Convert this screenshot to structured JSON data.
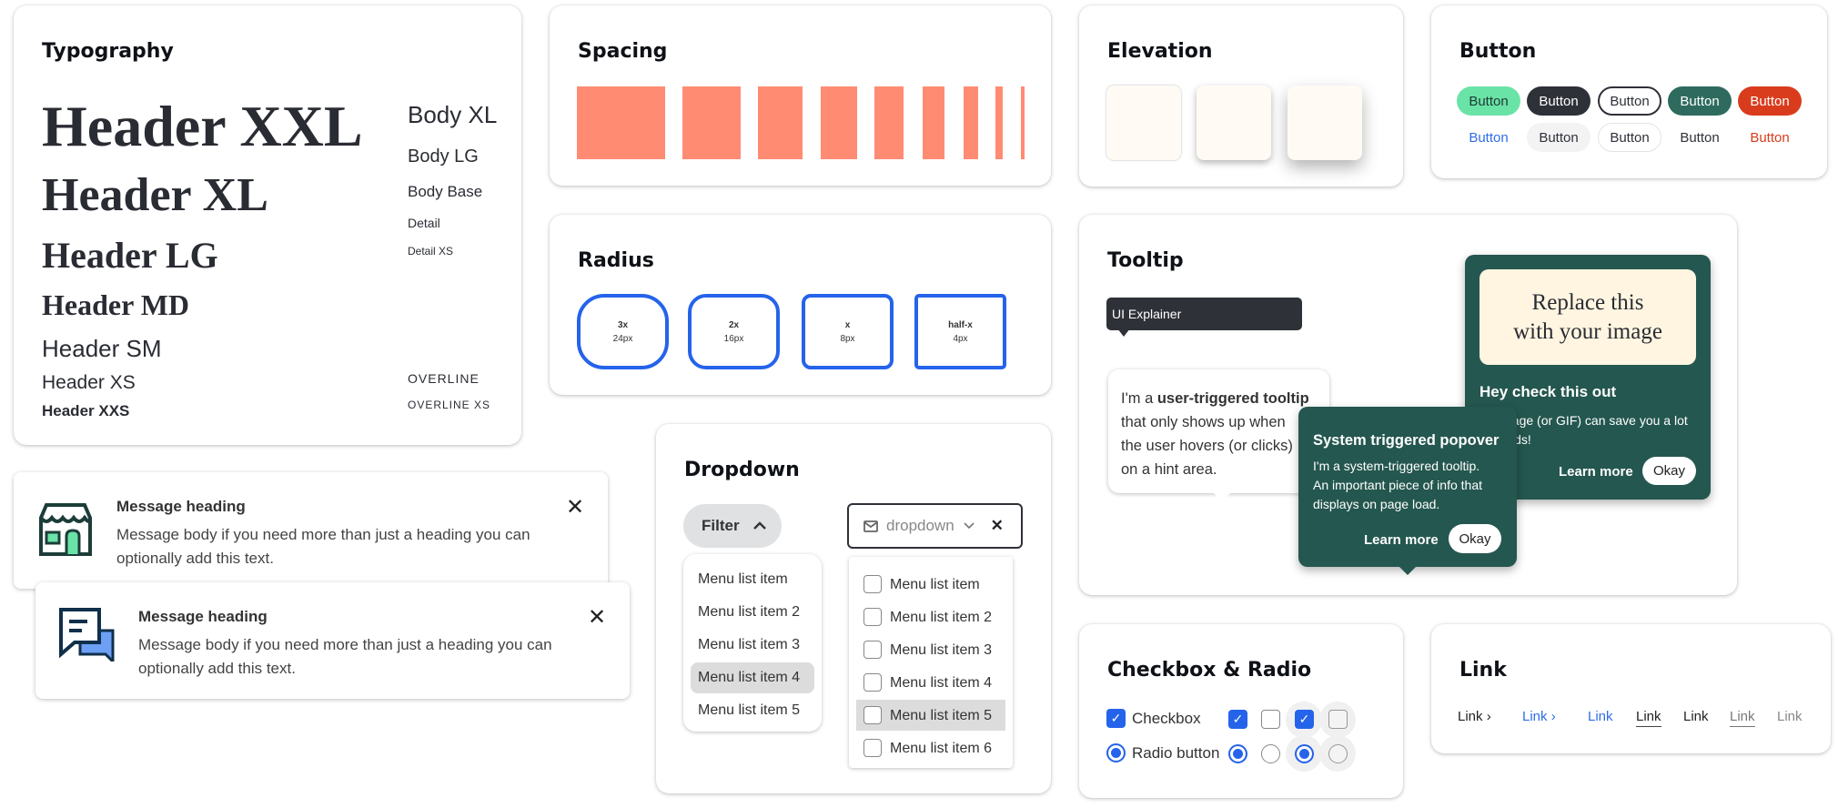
{
  "typography": {
    "title": "Typography",
    "headers": [
      "Header XXL",
      "Header XL",
      "Header LG",
      "Header MD",
      "Header SM",
      "Header XS",
      "Header XXS"
    ],
    "body": [
      "Body XL",
      "Body LG",
      "Body Base",
      "Detail",
      "Detail XS"
    ],
    "overline": [
      "OVERLINE",
      "OVERLINE XS"
    ]
  },
  "spacing": {
    "title": "Spacing",
    "color": "#ff8b73"
  },
  "radius": {
    "title": "Radius",
    "items": [
      {
        "name": "3x",
        "value": "24px"
      },
      {
        "name": "2x",
        "value": "16px"
      },
      {
        "name": "x",
        "value": "8px"
      },
      {
        "name": "half-x",
        "value": "4px"
      }
    ],
    "color": "#2563eb"
  },
  "dropdown": {
    "title": "Dropdown",
    "filter_label": "Filter",
    "select_placeholder": "dropdown",
    "menu1": [
      "Menu list item",
      "Menu list item 2",
      "Menu list item 3",
      "Menu list item 4",
      "Menu list item 5"
    ],
    "menu1_highlighted": 4,
    "menu2": [
      "Menu list item",
      "Menu list item 2",
      "Menu list item 3",
      "Menu list item 4",
      "Menu list item 5",
      "Menu list item 6"
    ],
    "menu2_highlighted": 5
  },
  "elevation": {
    "title": "Elevation"
  },
  "button": {
    "title": "Button",
    "label": "Button",
    "colors": {
      "green": "#6ae3a7",
      "dark": "#2f3139",
      "teal": "#2e6b5e",
      "red": "#d93c1d",
      "blue": "#2e6ee6"
    }
  },
  "tooltip": {
    "title": "Tooltip",
    "explainer": "UI Explainer",
    "user_pre": "I'm a ",
    "user_bold": "user-triggered tooltip",
    "user_lines": [
      "that only shows up when",
      "the user hovers (or clicks)",
      "on a hint area."
    ],
    "image_placeholder": [
      "Replace this",
      "with your image"
    ],
    "big_heading": "Hey check this out",
    "big_body": [
      "An image (or GIF) can save you a lot",
      "of words!"
    ],
    "system_heading": "System triggered popover",
    "system_body": [
      "I'm a system-triggered tooltip.",
      "An important piece of info that",
      "displays on page load."
    ],
    "learn_more": "Learn more",
    "okay": "Okay",
    "green": "#24574f"
  },
  "checkbox": {
    "title": "Checkbox & Radio",
    "checkbox_label": "Checkbox",
    "radio_label": "Radio button"
  },
  "link": {
    "title": "Link",
    "label": "Link"
  },
  "messages": [
    {
      "heading": "Message heading",
      "body": "Message body if you need more than just a heading you can optionally add this text.",
      "icon": "storefront-icon"
    },
    {
      "heading": "Message heading",
      "body": "Message body if you need more than just a heading you can optionally add this text.",
      "icon": "chat-bubbles-icon"
    }
  ]
}
